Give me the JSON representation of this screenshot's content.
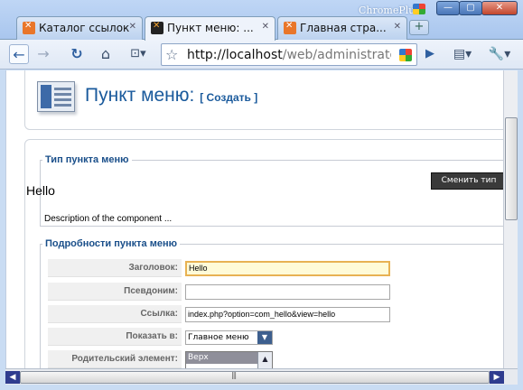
{
  "browser": {
    "brand": "ChromePlus",
    "tabs": [
      {
        "label": "Каталог ссылок",
        "icon": "xampp-favicon-icon",
        "active": false
      },
      {
        "label": "Пункт меню: ...",
        "icon": "joomla-favicon-icon",
        "active": true
      },
      {
        "label": "Главная стра...",
        "icon": "xampp-favicon-icon",
        "active": false
      }
    ],
    "new_tab_label": "+",
    "address": {
      "domain": "http://localhost",
      "path": "/web/administrato"
    }
  },
  "page": {
    "title": "Пункт меню:",
    "subtitle": "[ Создать ]",
    "type_section": {
      "legend": "Тип пункта меню",
      "component_name": "Hello",
      "change_button": "Сменить тип",
      "description": "Description of the component ..."
    },
    "details_section": {
      "legend": "Подробности пункта меню",
      "fields": {
        "title_label": "Заголовок:",
        "title_value": "Hello",
        "alias_label": "Псевдоним:",
        "alias_value": "",
        "link_label": "Ссылка:",
        "link_value": "index.php?option=com_hello&view=hello",
        "show_in_label": "Показать в:",
        "show_in_value": "Главное меню",
        "parent_label": "Родительский элемент:",
        "parent_value": "Верх"
      }
    }
  },
  "colors": {
    "accent": "#1a5a9c",
    "legend": "#1a4f8a",
    "focus_border": "#e8b253"
  }
}
